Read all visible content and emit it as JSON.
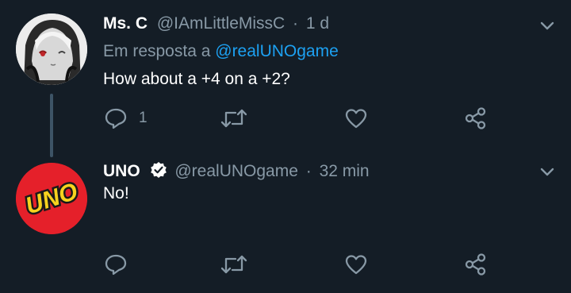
{
  "tweets": [
    {
      "name": "Ms. C",
      "handle": "@IAmLittleMissC",
      "separator": "·",
      "time": "1 d",
      "reply_prefix": "Em resposta a",
      "reply_to": "@realUNOgame",
      "text": "How about a +4 on a +2?",
      "reply_count": "1"
    },
    {
      "name": "UNO",
      "handle": "@realUNOgame",
      "separator": "·",
      "time": "32 min",
      "text": "No!",
      "avatar_text": "UNO"
    }
  ],
  "icons": {
    "reply": "reply-icon",
    "retweet": "retweet-icon",
    "like": "heart-icon",
    "share": "share-icon",
    "menu": "chevron-down-icon",
    "verified": "verified-badge-icon"
  },
  "colors": {
    "background": "#141d26",
    "secondary_text": "#8899a6",
    "link": "#1da1f2",
    "uno_red": "#e5202a",
    "uno_yellow": "#f7d21e"
  }
}
